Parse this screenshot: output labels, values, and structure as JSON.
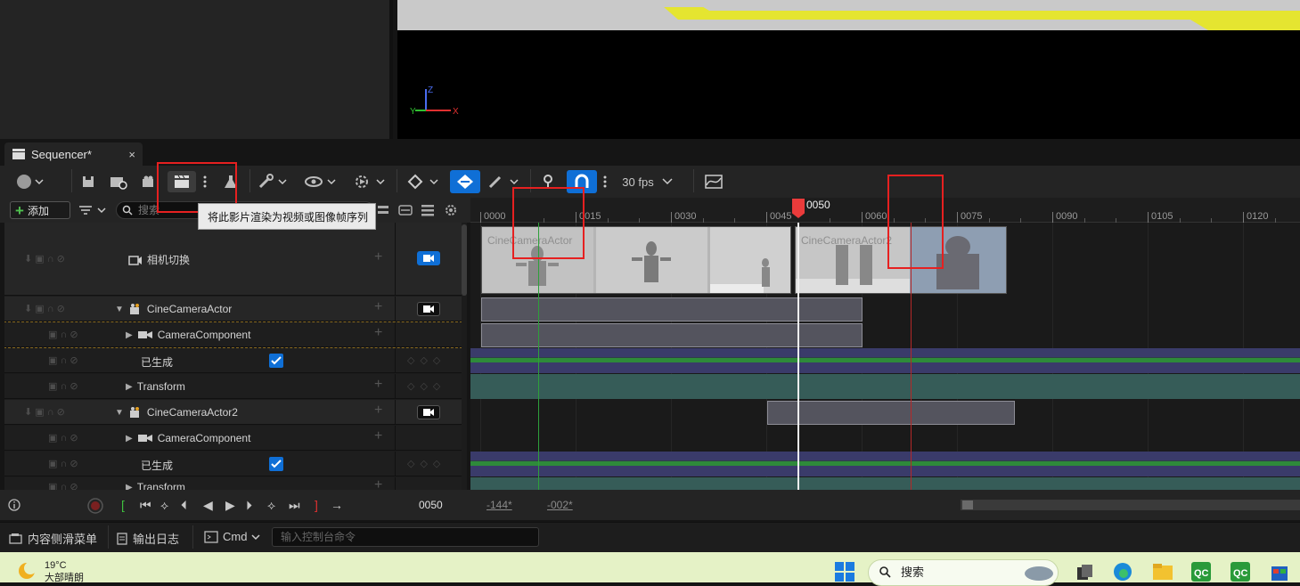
{
  "tab": {
    "title": "Sequencer*",
    "close": "×"
  },
  "toolbar": {
    "fps_label": "30 fps",
    "tooltip": "将此影片渲染为视频或图像帧序列"
  },
  "row2": {
    "add_label": "添加",
    "search_placeholder": "搜索"
  },
  "ruler": {
    "ticks": [
      "0000",
      "0015",
      "0030",
      "0045",
      "0060",
      "0075",
      "0090",
      "0105",
      "0120"
    ],
    "playhead": "0050"
  },
  "tracks": {
    "camera_cut": "相机切换",
    "actor1": "CineCameraActor",
    "actor1_component": "CameraComponent",
    "actor1_spawned": "已生成",
    "actor1_transform": "Transform",
    "actor2": "CineCameraActor2",
    "actor2_component": "CameraComponent",
    "actor2_spawned": "已生成",
    "actor2_transform": "Transform"
  },
  "shots": {
    "shot1": "CineCameraActor",
    "shot2": "CineCameraActor2"
  },
  "transport": {
    "frame": "0050",
    "range_start": "-144*",
    "range_end": "-002*"
  },
  "statusbar": {
    "content_drawer": "内容侧滑菜单",
    "output_log": "输出日志",
    "cmd": "Cmd",
    "console_placeholder": "输入控制台命令"
  },
  "taskbar": {
    "temperature": "19°C",
    "weather": "大部晴朗",
    "search": "搜索"
  },
  "colors": {
    "accent": "#0f6fd6",
    "playhead": "#ea3b3b",
    "annotation": "#e62020"
  }
}
